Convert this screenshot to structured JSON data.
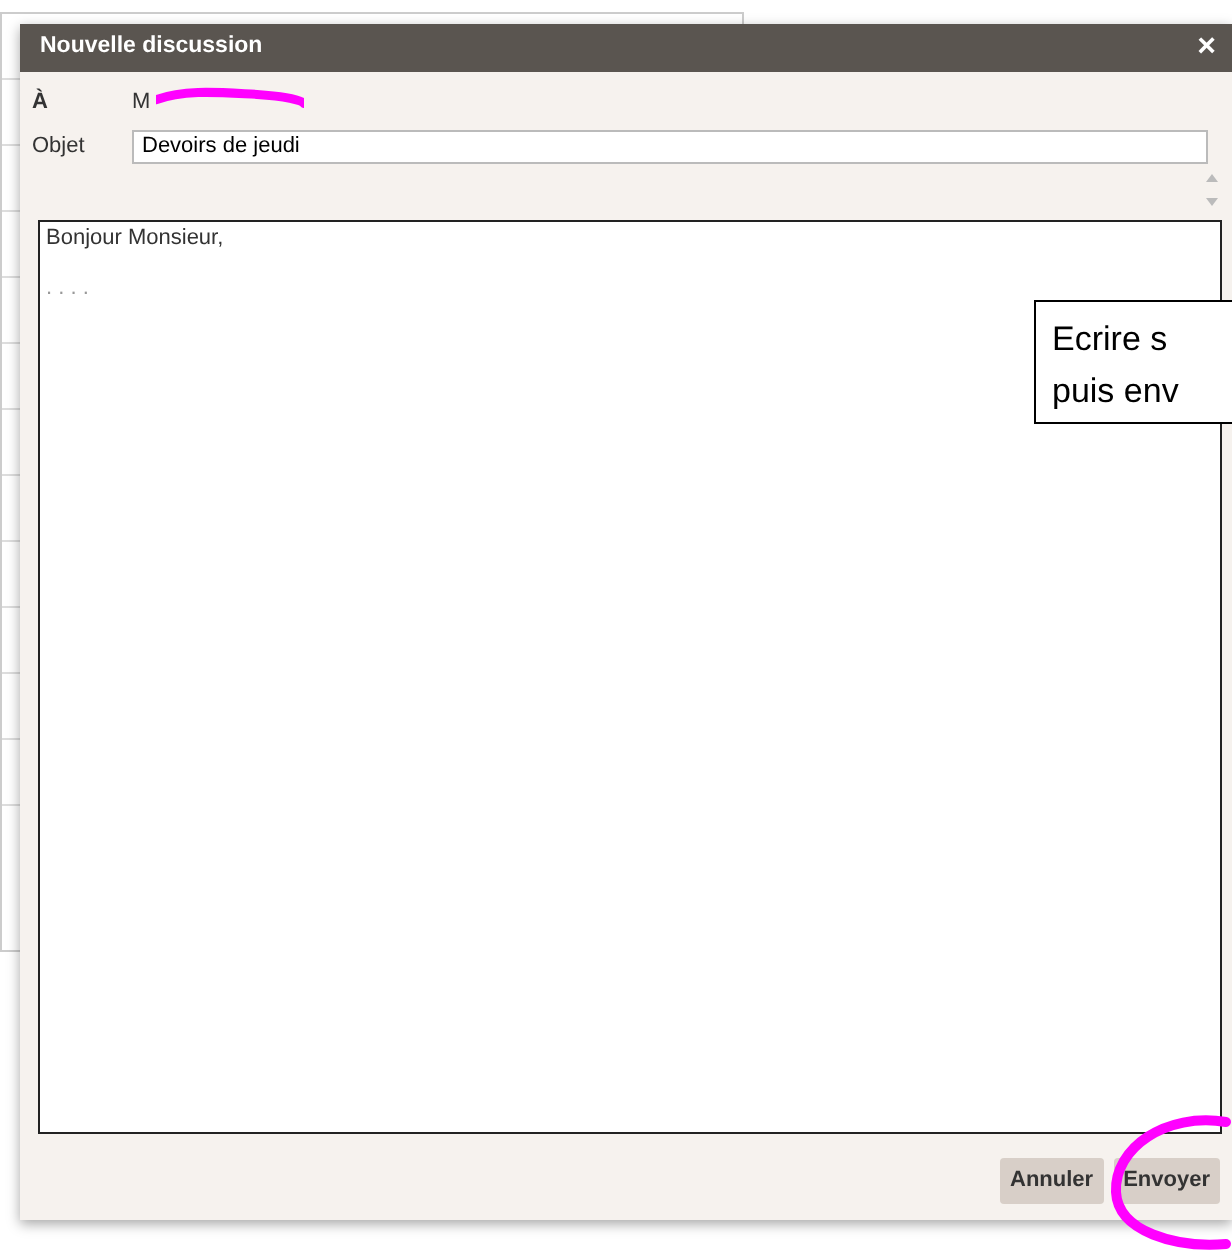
{
  "dialog": {
    "title": "Nouvelle discussion",
    "close": "×"
  },
  "fields": [
    {
      "kind": "static",
      "label": "À",
      "value": "M"
    },
    {
      "kind": "input",
      "label": "Objet",
      "value": "Devoirs de jeudi"
    }
  ],
  "message": {
    "lines": [
      "Bonjour Monsieur,",
      ". . . ."
    ]
  },
  "callout": {
    "lines": [
      "Ecrire s",
      "puis env"
    ]
  },
  "buttons": [
    {
      "label": "Annuler"
    },
    {
      "label": "Envoyer"
    }
  ]
}
